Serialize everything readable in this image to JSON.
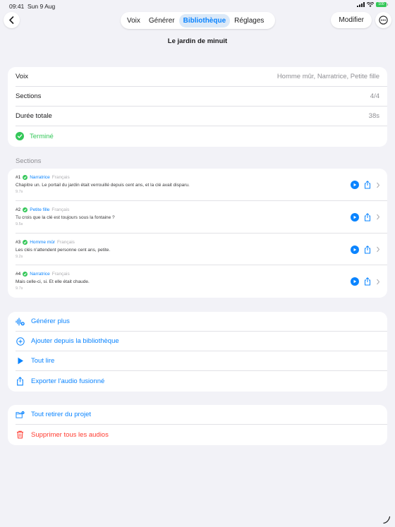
{
  "status_bar": {
    "time": "09:41",
    "date": "Sun 9 Aug",
    "battery_label": "100"
  },
  "nav": {
    "tabs": [
      {
        "label": "Voix",
        "active": false
      },
      {
        "label": "Générer",
        "active": false
      },
      {
        "label": "Bibliothèque",
        "active": true
      },
      {
        "label": "Réglages",
        "active": false
      }
    ],
    "edit_label": "Modifier",
    "back_icon": "chevron-left-icon",
    "more_icon": "ellipsis-circle-icon"
  },
  "project_title": "Le jardin de minuit",
  "info": {
    "voice_label": "Voix",
    "voice_value": "Homme mûr, Narratrice, Petite fille",
    "sections_label": "Sections",
    "sections_value": "4/4",
    "duration_label": "Durée totale",
    "duration_value": "38s",
    "status_label": "Terminé"
  },
  "sections_heading": "Sections",
  "sections": [
    {
      "num": "#1",
      "voice": "Narratrice",
      "lang": "Français",
      "text": "Chapitre un. Le portail du jardin était verrouillé depuis cent ans, et la clé avait disparu.",
      "duration": "9.7s"
    },
    {
      "num": "#2",
      "voice": "Petite fille",
      "lang": "Français",
      "text": "Tu crois que la clé est toujours sous la fontaine ?",
      "duration": "9.5s"
    },
    {
      "num": "#3",
      "voice": "Homme mûr",
      "lang": "Français",
      "text": "Les clés n'attendent personne cent ans, petite.",
      "duration": "9.2s"
    },
    {
      "num": "#4",
      "voice": "Narratrice",
      "lang": "Français",
      "text": "Mais celle-ci, si. Et elle était chaude.",
      "duration": "9.7s"
    }
  ],
  "actions": {
    "generate_more": "Générer plus",
    "add_from_library": "Ajouter depuis la bibliothèque",
    "play_all": "Tout lire",
    "export_merged": "Exporter l'audio fusionné"
  },
  "danger": {
    "remove_all": "Tout retirer du projet",
    "delete_all": "Supprimer tous les audios"
  },
  "colors": {
    "accent": "#0a84ff",
    "success": "#34c759",
    "destructive": "#ff3b30",
    "background": "#f2f2f7"
  }
}
